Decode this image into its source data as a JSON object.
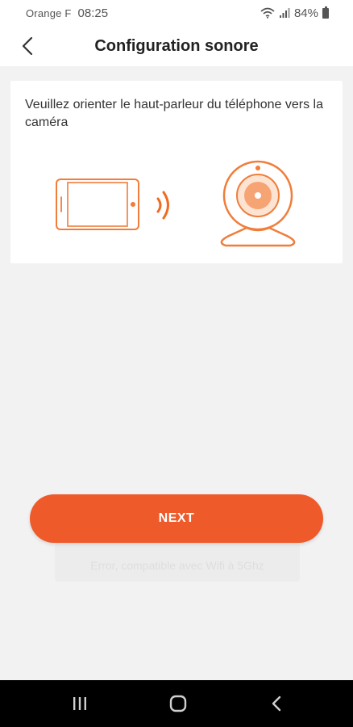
{
  "status_bar": {
    "carrier": "Orange F",
    "time": "08:25",
    "battery": "84%",
    "icons": [
      "wifi-icon",
      "signal-icon",
      "battery-icon"
    ]
  },
  "header": {
    "title": "Configuration sonore",
    "back_icon": "chevron-left-icon"
  },
  "card": {
    "instruction": "Veuillez orienter le haut-parleur du téléphone vers la caméra",
    "illustrations": [
      "phone-icon",
      "sound-waves-icon",
      "webcam-icon"
    ]
  },
  "actions": {
    "next_label": "NEXT",
    "secondary_label": "Error, compatible avec Wifi à 5Ghz"
  },
  "nav_bar": {
    "icons": [
      "recent-apps-icon",
      "home-icon",
      "back-icon"
    ]
  },
  "colors": {
    "accent": "#ee5a2a",
    "illustration_orange": "#f07d3a",
    "background": "#f2f2f2",
    "card": "#ffffff"
  }
}
